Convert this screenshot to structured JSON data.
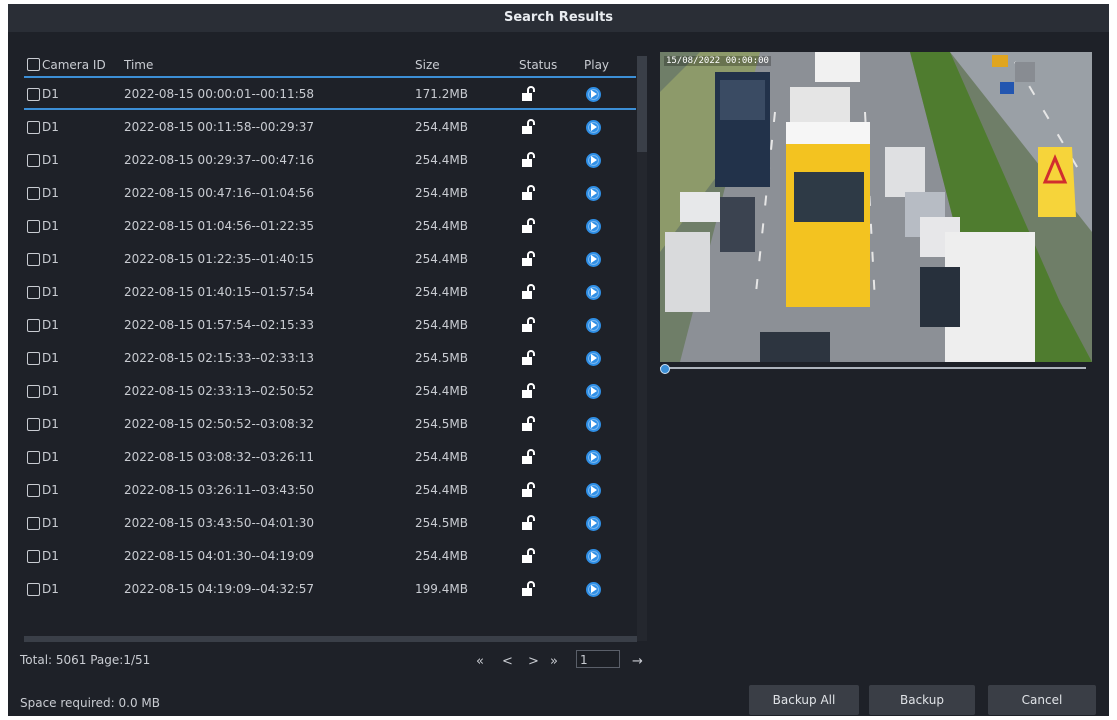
{
  "dialog": {
    "title": "Search Results"
  },
  "table": {
    "headers": {
      "camera_id": "Camera ID",
      "time": "Time",
      "size": "Size",
      "status": "Status",
      "play": "Play"
    },
    "rows": [
      {
        "camera_id": "D1",
        "time": "2022-08-15 00:00:01--00:11:58",
        "size": "171.2MB"
      },
      {
        "camera_id": "D1",
        "time": "2022-08-15 00:11:58--00:29:37",
        "size": "254.4MB"
      },
      {
        "camera_id": "D1",
        "time": "2022-08-15 00:29:37--00:47:16",
        "size": "254.4MB"
      },
      {
        "camera_id": "D1",
        "time": "2022-08-15 00:47:16--01:04:56",
        "size": "254.4MB"
      },
      {
        "camera_id": "D1",
        "time": "2022-08-15 01:04:56--01:22:35",
        "size": "254.4MB"
      },
      {
        "camera_id": "D1",
        "time": "2022-08-15 01:22:35--01:40:15",
        "size": "254.4MB"
      },
      {
        "camera_id": "D1",
        "time": "2022-08-15 01:40:15--01:57:54",
        "size": "254.4MB"
      },
      {
        "camera_id": "D1",
        "time": "2022-08-15 01:57:54--02:15:33",
        "size": "254.4MB"
      },
      {
        "camera_id": "D1",
        "time": "2022-08-15 02:15:33--02:33:13",
        "size": "254.5MB"
      },
      {
        "camera_id": "D1",
        "time": "2022-08-15 02:33:13--02:50:52",
        "size": "254.4MB"
      },
      {
        "camera_id": "D1",
        "time": "2022-08-15 02:50:52--03:08:32",
        "size": "254.5MB"
      },
      {
        "camera_id": "D1",
        "time": "2022-08-15 03:08:32--03:26:11",
        "size": "254.4MB"
      },
      {
        "camera_id": "D1",
        "time": "2022-08-15 03:26:11--03:43:50",
        "size": "254.4MB"
      },
      {
        "camera_id": "D1",
        "time": "2022-08-15 03:43:50--04:01:30",
        "size": "254.5MB"
      },
      {
        "camera_id": "D1",
        "time": "2022-08-15 04:01:30--04:19:09",
        "size": "254.4MB"
      },
      {
        "camera_id": "D1",
        "time": "2022-08-15 04:19:09--04:32:57",
        "size": "199.4MB"
      }
    ],
    "status_icon": "unlocked-icon",
    "play_icon": "play-icon"
  },
  "footer": {
    "total": "Total: 5061  Page:1/51",
    "page_value": "1",
    "space_required": "Space required: 0.0 MB"
  },
  "pager": {
    "first": "«",
    "prev": "<",
    "next": ">",
    "last": "»",
    "go": "→"
  },
  "buttons": {
    "backup_all": "Backup All",
    "backup": "Backup",
    "cancel": "Cancel"
  },
  "video": {
    "timestamp": "15/08/2022 00:00:00"
  },
  "colors": {
    "accent": "#3c8fd6",
    "play": "#2f8fe6",
    "background": "#1e2128",
    "text": "#c9ccd2"
  }
}
